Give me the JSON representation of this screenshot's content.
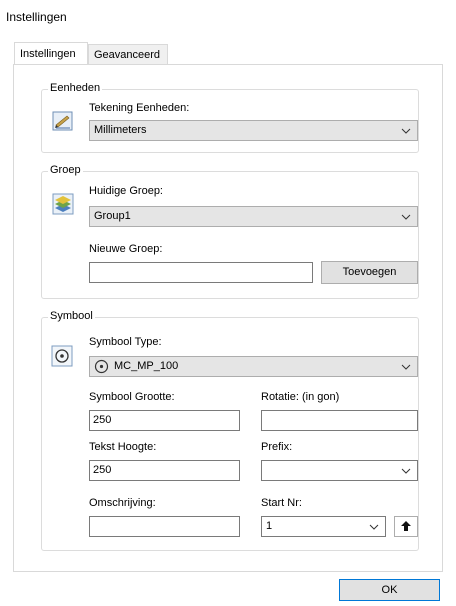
{
  "window": {
    "title": "Instellingen"
  },
  "tabs": [
    {
      "label": "Instellingen",
      "active": true
    },
    {
      "label": "Geavanceerd",
      "active": false
    }
  ],
  "eenheden": {
    "group_label": "Eenheden",
    "tekening_label": "Tekening Eenheden:",
    "tekening_value": "Millimeters",
    "icon": "drawing-units-icon"
  },
  "groep": {
    "group_label": "Groep",
    "huidige_label": "Huidige Groep:",
    "huidige_value": "Group1",
    "nieuwe_label": "Nieuwe Groep:",
    "nieuwe_value": "",
    "add_button": "Toevoegen",
    "icon": "layers-icon"
  },
  "symbool": {
    "group_label": "Symbool",
    "type_label": "Symbool Type:",
    "type_value": "MC_MP_100",
    "grootte_label": "Symbool Grootte:",
    "grootte_value": "250",
    "rotatie_label": "Rotatie: (in gon)",
    "rotatie_value": "",
    "tekst_label": "Tekst Hoogte:",
    "tekst_value": "250",
    "prefix_label": "Prefix:",
    "prefix_value": "",
    "omschrijving_label": "Omschrijving:",
    "omschrijving_value": "",
    "startnr_label": "Start Nr:",
    "startnr_value": "1",
    "icon": "circle-target-icon"
  },
  "footer": {
    "ok_label": "OK"
  },
  "colors": {
    "default_button_border": "#0078d7",
    "combo_bg": "#e5e5e5",
    "panel_border": "#d9d9d9"
  }
}
